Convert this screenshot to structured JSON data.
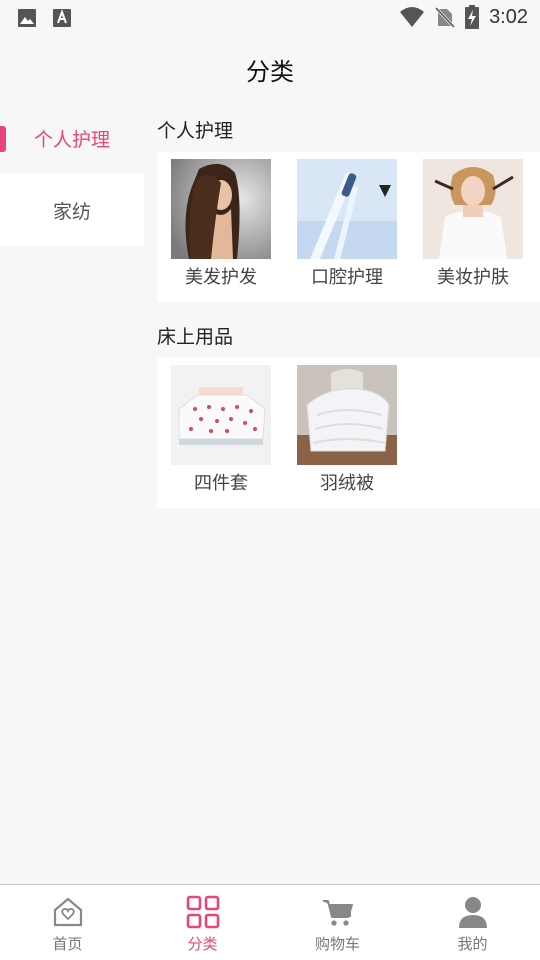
{
  "status": {
    "time": "3:02"
  },
  "header": {
    "title": "分类"
  },
  "sidebar": {
    "items": [
      {
        "label": "个人护理",
        "active": true
      },
      {
        "label": "家纺",
        "active": false
      }
    ]
  },
  "sections": [
    {
      "title": "个人护理",
      "items": [
        {
          "label": "美发护发"
        },
        {
          "label": "口腔护理"
        },
        {
          "label": "美妆护肤"
        }
      ]
    },
    {
      "title": "床上用品",
      "items": [
        {
          "label": "四件套"
        },
        {
          "label": "羽绒被"
        }
      ]
    }
  ],
  "tabbar": {
    "tabs": [
      {
        "label": "首页",
        "icon": "home-icon"
      },
      {
        "label": "分类",
        "icon": "category-icon",
        "active": true
      },
      {
        "label": "购物车",
        "icon": "cart-icon"
      },
      {
        "label": "我的",
        "icon": "user-icon"
      }
    ]
  },
  "colors": {
    "accent": "#e8457b",
    "background": "#f7f7f7",
    "card": "#ffffff"
  }
}
